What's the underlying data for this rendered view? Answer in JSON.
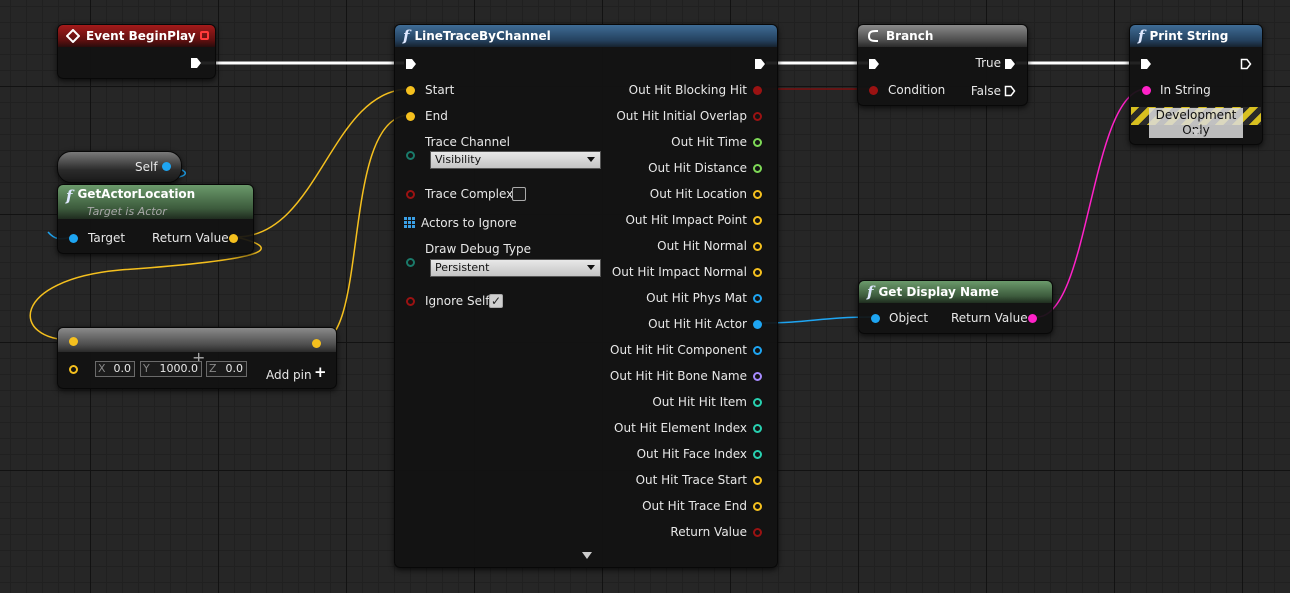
{
  "colors": {
    "exec": "#ffffff",
    "vector": "#f5c01e",
    "object": "#1ea5f2",
    "bool": "#9b1212",
    "float": "#7ed957",
    "string": "#ff22c8",
    "enum": "#1a7a6a",
    "name": "#a78bff",
    "int": "#28d0b0",
    "array": "#3aa0e6"
  },
  "nodes": {
    "begin_play": {
      "title": "Event BeginPlay",
      "icon": "event-diamond-icon"
    },
    "self": {
      "label": "Self"
    },
    "get_actor_location": {
      "title": "GetActorLocation",
      "subtitle": "Target is Actor",
      "target": "Target",
      "return_value": "Return Value",
      "icon": "function-icon"
    },
    "make_vector": {
      "x_label": "X",
      "x": "0.0",
      "y_label": "Y",
      "y": "1000.0",
      "z_label": "Z",
      "z": "0.0",
      "add_pin": "Add pin"
    },
    "line_trace": {
      "title": "LineTraceByChannel",
      "icon": "function-icon",
      "inputs": {
        "start": "Start",
        "end": "End",
        "trace_channel": "Trace Channel",
        "trace_channel_value": "Visibility",
        "trace_complex": "Trace Complex",
        "actors_to_ignore": "Actors to Ignore",
        "draw_debug_type": "Draw Debug Type",
        "draw_debug_value": "Persistent",
        "ignore_self": "Ignore Self"
      },
      "outputs": [
        {
          "label": "Out Hit Blocking Hit",
          "kind": "bool",
          "filled": true
        },
        {
          "label": "Out Hit Initial Overlap",
          "kind": "bool",
          "filled": false
        },
        {
          "label": "Out Hit Time",
          "kind": "float",
          "filled": false
        },
        {
          "label": "Out Hit Distance",
          "kind": "float",
          "filled": false
        },
        {
          "label": "Out Hit Location",
          "kind": "vector",
          "filled": false
        },
        {
          "label": "Out Hit Impact Point",
          "kind": "vector",
          "filled": false
        },
        {
          "label": "Out Hit Normal",
          "kind": "vector",
          "filled": false
        },
        {
          "label": "Out Hit Impact Normal",
          "kind": "vector",
          "filled": false
        },
        {
          "label": "Out Hit Phys Mat",
          "kind": "object",
          "filled": false
        },
        {
          "label": "Out Hit Hit Actor",
          "kind": "object",
          "filled": true
        },
        {
          "label": "Out Hit Hit Component",
          "kind": "object",
          "filled": false
        },
        {
          "label": "Out Hit Hit Bone Name",
          "kind": "name",
          "filled": false
        },
        {
          "label": "Out Hit Hit Item",
          "kind": "int",
          "filled": false
        },
        {
          "label": "Out Hit Element Index",
          "kind": "int",
          "filled": false
        },
        {
          "label": "Out Hit Face Index",
          "kind": "int",
          "filled": false
        },
        {
          "label": "Out Hit Trace Start",
          "kind": "vector",
          "filled": false
        },
        {
          "label": "Out Hit Trace End",
          "kind": "vector",
          "filled": false
        },
        {
          "label": "Return Value",
          "kind": "bool",
          "filled": false
        }
      ]
    },
    "branch": {
      "title": "Branch",
      "icon": "branch-icon",
      "condition": "Condition",
      "true_label": "True",
      "false_label": "False"
    },
    "get_display_name": {
      "title": "Get Display Name",
      "icon": "function-icon",
      "object": "Object",
      "return_value": "Return Value"
    },
    "print_string": {
      "title": "Print String",
      "icon": "function-icon",
      "in_string": "In String",
      "dev_only": "Development Only"
    }
  }
}
